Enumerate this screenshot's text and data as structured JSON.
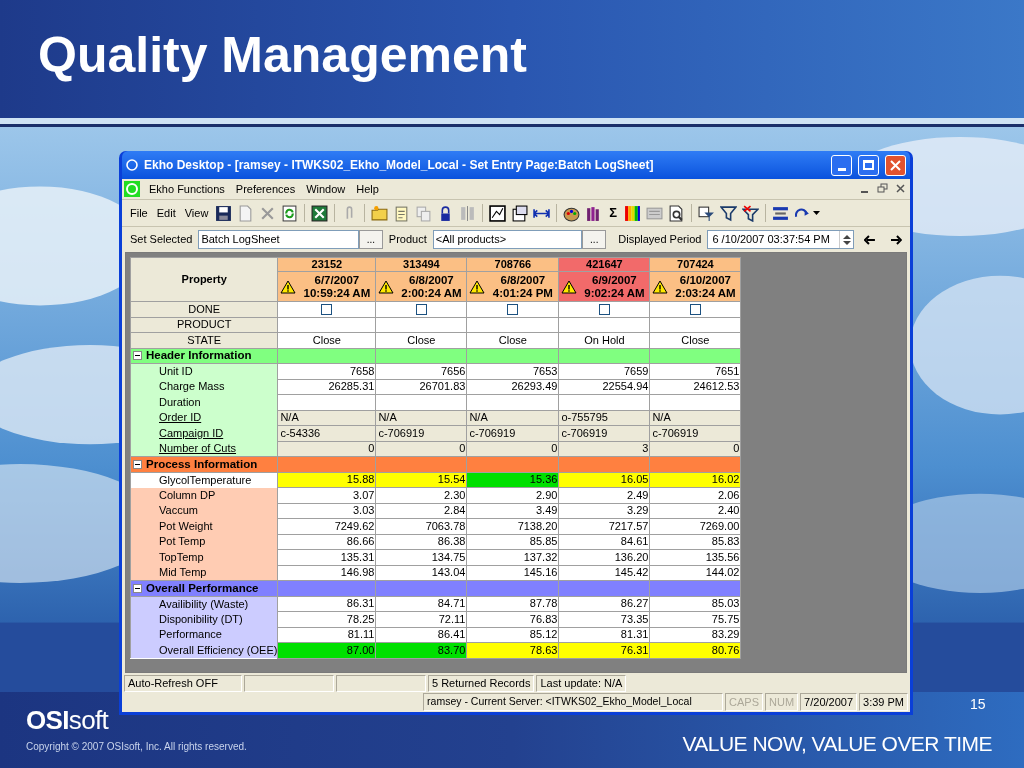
{
  "slide": {
    "title": "Quality Management",
    "number": "15",
    "logo": "**OSI**soft",
    "copyright": "Copyright © 2007 OSIsoft, Inc. All rights reserved.",
    "tagline": "VALUE NOW, VALUE OVER TIME"
  },
  "window": {
    "title": "Ekho Desktop - [ramsey - ITWKS02_Ekho_Model_Local - Set Entry Page:Batch LogSheet]",
    "menus": [
      "Ekho Functions",
      "Preferences",
      "Window",
      "Help"
    ],
    "toolbar_menus": [
      "File",
      "Edit",
      "View"
    ],
    "toolbar_symbol": "Σ",
    "selectors": [
      {
        "label": "Set Selected",
        "value": "Batch LogSheet",
        "button": "..."
      },
      {
        "label": "Product",
        "value": "<All products>",
        "button": "..."
      }
    ],
    "period": {
      "label": "Displayed Period",
      "value": "6 /10/2007 03:37:54 PM"
    },
    "grid": {
      "property_header": "Property",
      "columns": [
        {
          "id": "23152",
          "date": "6/7/2007",
          "time": "10:59:24 AM",
          "color": "#fbbf84"
        },
        {
          "id": "313494",
          "date": "6/8/2007",
          "time": "2:00:24 AM",
          "color": "#fbbf84"
        },
        {
          "id": "708766",
          "date": "6/8/2007",
          "time": "4:01:24 PM",
          "color": "#fbbf84"
        },
        {
          "id": "421647",
          "date": "6/9/2007",
          "time": "9:02:24 AM",
          "color": "#f26a6a"
        },
        {
          "id": "707424",
          "date": "6/10/2007",
          "time": "2:03:24 AM",
          "color": "#fbbf84"
        }
      ],
      "fixed_rows": [
        {
          "label": "DONE",
          "kind": "checkbox",
          "cells": [
            {
              "checked": false
            },
            {
              "checked": false
            },
            {
              "checked": false
            },
            {
              "checked": false
            },
            {
              "checked": false
            }
          ]
        },
        {
          "label": "PRODUCT",
          "kind": "empty"
        },
        {
          "label": "STATE",
          "kind": "state",
          "cells": [
            "Close",
            "Close",
            "Close",
            "On Hold",
            "Close"
          ]
        }
      ],
      "sections": [
        {
          "title": "Header Information",
          "color": "#80ff80",
          "expanded": true,
          "rows": [
            {
              "label": "Unit ID",
              "kind": "number",
              "link": false,
              "selected": false,
              "cells": [
                "7658",
                "7656",
                "7653",
                "7659",
                "7651"
              ]
            },
            {
              "label": "Charge Mass",
              "kind": "number",
              "link": false,
              "selected": false,
              "cells": [
                "26285.31",
                "26701.83",
                "26293.49",
                "22554.94",
                "24612.53"
              ]
            },
            {
              "label": "Duration",
              "kind": "empty",
              "link": false,
              "selected": false
            },
            {
              "label": "Order ID",
              "kind": "text",
              "link": true,
              "selected": false,
              "cells": [
                "N/A",
                "N/A",
                "N/A",
                "o-755795",
                "N/A"
              ]
            },
            {
              "label": "Campaign ID",
              "kind": "text",
              "link": true,
              "selected": false,
              "cells": [
                "c-54336",
                "c-706919",
                "c-706919",
                "c-706919",
                "c-706919"
              ]
            },
            {
              "label": "Number of Cuts",
              "kind": "number",
              "link": true,
              "selected": false,
              "cells": [
                "0",
                "0",
                "0",
                "3",
                "0"
              ]
            }
          ]
        },
        {
          "title": "Process Information",
          "color": "#ff8040",
          "expanded": true,
          "rows": [
            {
              "label": "GlycolTemperature",
              "kind": "number",
              "link": false,
              "selected": true,
              "cells": [
                {
                  "text": "15.88",
                  "color": "#ffff00"
                },
                {
                  "text": "15.54",
                  "color": "#ffff00"
                },
                {
                  "text": "15.36",
                  "color": "#00e000"
                },
                {
                  "text": "16.05",
                  "color": "#ffff00"
                },
                {
                  "text": "16.02",
                  "color": "#ffff00"
                }
              ]
            },
            {
              "label": "Column DP",
              "kind": "number",
              "link": false,
              "selected": false,
              "cells": [
                "3.07",
                "2.30",
                "2.90",
                "2.49",
                "2.06"
              ]
            },
            {
              "label": "Vaccum",
              "kind": "number",
              "link": false,
              "selected": false,
              "cells": [
                "3.03",
                "2.84",
                "3.49",
                "3.29",
                "2.40"
              ]
            },
            {
              "label": "Pot Weight",
              "kind": "number",
              "link": false,
              "selected": false,
              "cells": [
                "7249.62",
                "7063.78",
                "7138.20",
                "7217.57",
                "7269.00"
              ]
            },
            {
              "label": "Pot Temp",
              "kind": "number",
              "link": false,
              "selected": false,
              "cells": [
                "86.66",
                "86.38",
                "85.85",
                "84.61",
                "85.83"
              ]
            },
            {
              "label": "TopTemp",
              "kind": "number",
              "link": false,
              "selected": false,
              "cells": [
                "135.31",
                "134.75",
                "137.32",
                "136.20",
                "135.56"
              ]
            },
            {
              "label": "Mid Temp",
              "kind": "number",
              "link": false,
              "selected": false,
              "cells": [
                "146.98",
                "143.04",
                "145.16",
                "145.42",
                "144.02"
              ]
            }
          ]
        },
        {
          "title": "Overall Performance",
          "color": "#8080ff",
          "expanded": true,
          "rows": [
            {
              "label": "Availibility (Waste)",
              "kind": "number",
              "link": false,
              "selected": false,
              "cells": [
                "86.31",
                "84.71",
                "87.78",
                "86.27",
                "85.03"
              ]
            },
            {
              "label": "Disponibility (DT)",
              "kind": "number",
              "link": false,
              "selected": false,
              "cells": [
                "78.25",
                "72.11",
                "76.83",
                "73.35",
                "75.75"
              ]
            },
            {
              "label": "Performance",
              "kind": "number",
              "link": false,
              "selected": false,
              "cells": [
                "81.11",
                "86.41",
                "85.12",
                "81.31",
                "83.29"
              ]
            },
            {
              "label": "Overall Efficiency (OEE)",
              "kind": "number",
              "link": false,
              "selected": false,
              "cells": [
                {
                  "text": "87.00",
                  "color": "#00e000"
                },
                {
                  "text": "83.70",
                  "color": "#00e000"
                },
                {
                  "text": "78.63",
                  "color": "#ffff00"
                },
                {
                  "text": "76.31",
                  "color": "#ffff00"
                },
                {
                  "text": "80.76",
                  "color": "#ffff00"
                }
              ]
            }
          ]
        }
      ]
    },
    "status_bar": [
      {
        "text": "Auto-Refresh OFF"
      },
      {
        "text": "5 Returned Records"
      },
      {
        "text": "Last update: N/A"
      }
    ],
    "status_bar_2": [
      {
        "text": "ramsey - Current Server: <ITWKS02_Ekho_Model_Local",
        "disabled": false
      },
      {
        "text": "CAPS",
        "disabled": true
      },
      {
        "text": "NUM",
        "disabled": true
      },
      {
        "text": "7/20/2007",
        "disabled": false
      },
      {
        "text": "3:39 PM",
        "disabled": false
      }
    ]
  }
}
